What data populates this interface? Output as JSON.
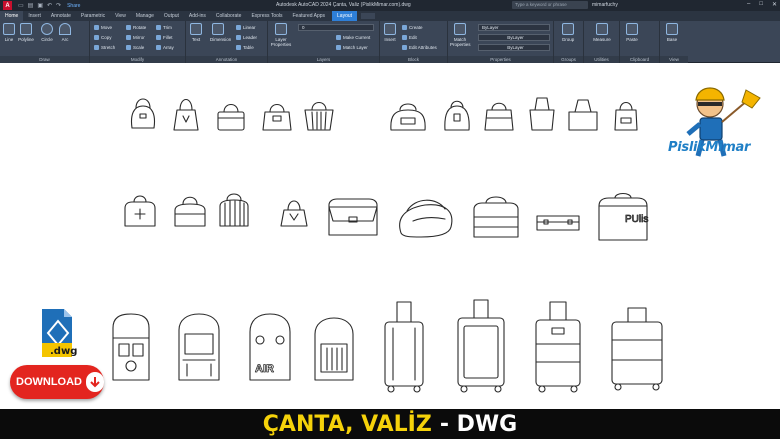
{
  "titlebar": {
    "app_badge": "A",
    "share_label": "Share",
    "window_title": "Autodesk AutoCAD 2024   Çanta, Valiz (PislikMimar.com).dwg",
    "search_placeholder": "Type a keyword or phrase",
    "user_name": "mimarfuchy"
  },
  "tabs": [
    "Home",
    "Insert",
    "Annotate",
    "Parametric",
    "View",
    "Manage",
    "Output",
    "Add-ins",
    "Collaborate",
    "Express Tools",
    "Featured Apps",
    "Layout"
  ],
  "ribbon": {
    "draw": {
      "title": "Draw",
      "tools": [
        "Line",
        "Polyline",
        "Circle",
        "Arc"
      ]
    },
    "modify": {
      "title": "Modify",
      "tools": [
        "Move",
        "Rotate",
        "Trim",
        "Copy",
        "Mirror",
        "Fillet",
        "Stretch",
        "Scale",
        "Array"
      ]
    },
    "annotation": {
      "title": "Annotation",
      "tools": [
        "Text",
        "Dimension",
        "Linear",
        "Leader",
        "Table"
      ]
    },
    "layers": {
      "title": "Layers",
      "tools": [
        "Layer Properties",
        "Make Current",
        "Match Layer"
      ],
      "current_layer": "0"
    },
    "block": {
      "title": "Block",
      "tools": [
        "Insert",
        "Create",
        "Edit",
        "Edit Attributes"
      ]
    },
    "properties": {
      "title": "Properties",
      "tools": [
        "Match Properties"
      ],
      "color": "ByLayer",
      "linetype": "ByLayer",
      "lineweight": "ByLayer"
    },
    "groups": {
      "title": "Groups",
      "tools": [
        "Group"
      ]
    },
    "utilities": {
      "title": "Utilities",
      "tools": [
        "Measure"
      ]
    },
    "clipboard": {
      "title": "Clipboard",
      "tools": [
        "Paste"
      ]
    },
    "view": {
      "title": "View",
      "tools": [
        "Base"
      ]
    }
  },
  "brand": {
    "name": "PislikMimar"
  },
  "file_badge": {
    "extension": ".dwg"
  },
  "download_button": {
    "label": "DOWNLOAD"
  },
  "banner": {
    "title": "ÇANTA, VALİZ",
    "suffix": "- DWG"
  },
  "colors": {
    "accent_blue": "#2e7fd8",
    "download_red": "#e3251f",
    "banner_yellow": "#f5d20a",
    "ribbon_bg": "#3b4657"
  }
}
